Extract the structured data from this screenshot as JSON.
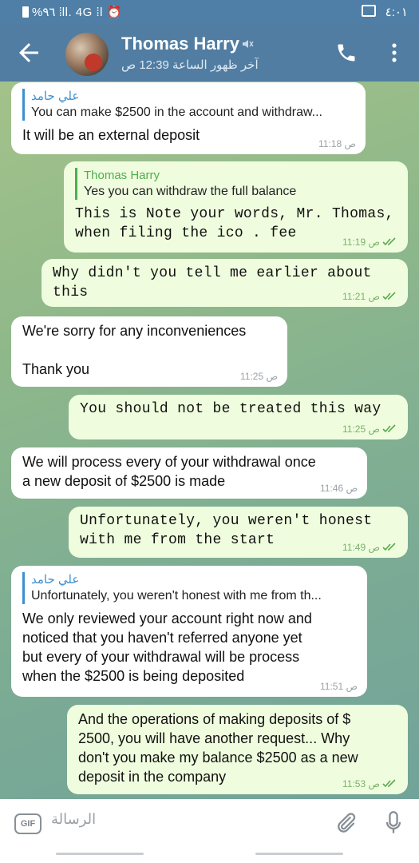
{
  "status": {
    "left": "%٩٦ ⁞ll. 4G ⁞l ⏰",
    "right": "٤:٠١"
  },
  "header": {
    "name": "Thomas Harry",
    "last_seen": "آخر ظهور الساعة 12:39 ص"
  },
  "messages": [
    {
      "type": "in",
      "reply_name": "علي حامد",
      "reply_text": "You can make $2500 in the account and withdraw...",
      "text": "It will be an external deposit",
      "time": "11:18 ص"
    },
    {
      "type": "out",
      "reply_name": "Thomas Harry",
      "reply_text": "Yes you can withdraw the full balance",
      "text": "This is Note your words, Mr. Thomas,\nwhen filing the ico . fee",
      "time": "11:19 ص"
    },
    {
      "type": "out",
      "text": "Why didn't you tell me earlier about\nthis",
      "time": "11:21 ص"
    },
    {
      "type": "in",
      "text": "We're sorry for any inconveniences\n\nThank you",
      "time": "11:25 ص"
    },
    {
      "type": "out",
      "text": "You should not be treated this way",
      "time": "11:25 ص"
    },
    {
      "type": "in",
      "text": "We will process every of your withdrawal once\na new deposit of $2500 is made",
      "time": "11:46 ص"
    },
    {
      "type": "out",
      "text": "Unfortunately, you weren't honest\nwith me from the start",
      "time": "11:49 ص"
    },
    {
      "type": "in",
      "reply_name": "علي حامد",
      "reply_text": "Unfortunately, you weren't honest with me from th...",
      "text": "We only reviewed your account right now and\nnoticed that you haven't referred anyone yet\nbut every of your withdrawal will be process\nwhen the $2500 is being deposited",
      "time": "11:51 ص"
    },
    {
      "type": "out",
      "text": "And the operations of making deposits of $\n2500, you will have another request... Why\ndon't you make my balance $2500 as a new\ndeposit in the company",
      "time": "11:53 ص"
    }
  ],
  "input": {
    "gif_label": "GIF",
    "placeholder": "الرسالة"
  },
  "colors": {
    "header": "#517da2",
    "incoming": "#ffffff",
    "outgoing": "#effdde",
    "accent": "#3d90d0"
  }
}
